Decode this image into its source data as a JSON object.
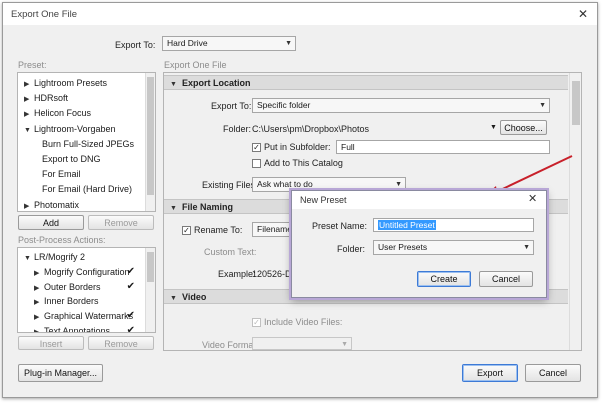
{
  "window": {
    "title": "Export One File"
  },
  "export_to": {
    "label": "Export To:",
    "value": "Hard Drive"
  },
  "preset": {
    "label": "Preset:",
    "items": [
      {
        "text": "Lightroom Presets",
        "expanded": false,
        "level": 0
      },
      {
        "text": "HDRsoft",
        "expanded": false,
        "level": 0
      },
      {
        "text": "Helicon Focus",
        "expanded": false,
        "level": 0
      },
      {
        "text": "Lightroom-Vorgaben",
        "expanded": true,
        "level": 0
      },
      {
        "text": "Burn Full-Sized JPEGs",
        "level": 1
      },
      {
        "text": "Export to DNG",
        "level": 1
      },
      {
        "text": "For Email",
        "level": 1
      },
      {
        "text": "For Email (Hard Drive)",
        "level": 1
      },
      {
        "text": "Photomatix",
        "expanded": false,
        "level": 0
      }
    ],
    "add_label": "Add",
    "remove_label": "Remove"
  },
  "post_process": {
    "label": "Post-Process Actions:",
    "items": [
      {
        "text": "LR/Mogrify 2",
        "expanded": true,
        "level": 0,
        "check": ""
      },
      {
        "text": "Mogrify Configuration",
        "expanded": false,
        "level": 1,
        "check": "✔"
      },
      {
        "text": "Outer Borders",
        "expanded": false,
        "level": 1,
        "check": "✔"
      },
      {
        "text": "Inner Borders",
        "expanded": false,
        "level": 1,
        "check": ""
      },
      {
        "text": "Graphical Watermarks",
        "expanded": false,
        "level": 1,
        "check": "✔"
      },
      {
        "text": "Text Annotations",
        "expanded": false,
        "level": 1,
        "check": "✔"
      }
    ],
    "insert_label": "Insert",
    "remove_label": "Remove"
  },
  "right_header": "Export One File",
  "export_location": {
    "header": "Export Location",
    "export_to_label": "Export To:",
    "export_to_value": "Specific folder",
    "folder_label": "Folder:",
    "folder_value": "C:\\Users\\pm\\Dropbox\\Photos",
    "choose_label": "Choose...",
    "subfolder_label": "Put in Subfolder:",
    "subfolder_value": "Full",
    "catalog_label": "Add to This Catalog",
    "existing_label": "Existing Files:",
    "existing_value": "Ask what to do"
  },
  "file_naming": {
    "header": "File Naming",
    "rename_label": "Rename To:",
    "rename_value": "Filename",
    "custom_text_label": "Custom Text:",
    "example_label": "Example:",
    "example_value": "120526-Deu"
  },
  "video": {
    "header": "Video",
    "include_label": "Include Video Files:",
    "format_label": "Video Format:"
  },
  "buttons": {
    "plugin_manager": "Plug-in Manager...",
    "export": "Export",
    "cancel": "Cancel"
  },
  "new_preset_dialog": {
    "title": "New Preset",
    "preset_name_label": "Preset Name:",
    "preset_name_value": "Untitled Preset",
    "folder_label": "Folder:",
    "folder_value": "User Presets",
    "create_label": "Create",
    "cancel_label": "Cancel"
  },
  "colors": {
    "annotation_arrow": "#c8202a",
    "selection": "#3399ff",
    "dialog_glow": "#b8a7d6"
  },
  "icons": {
    "close": "close-icon",
    "checkmark": "checkmark-icon",
    "dropdown": "chevron-down-icon",
    "expand": "triangle-right-icon"
  }
}
